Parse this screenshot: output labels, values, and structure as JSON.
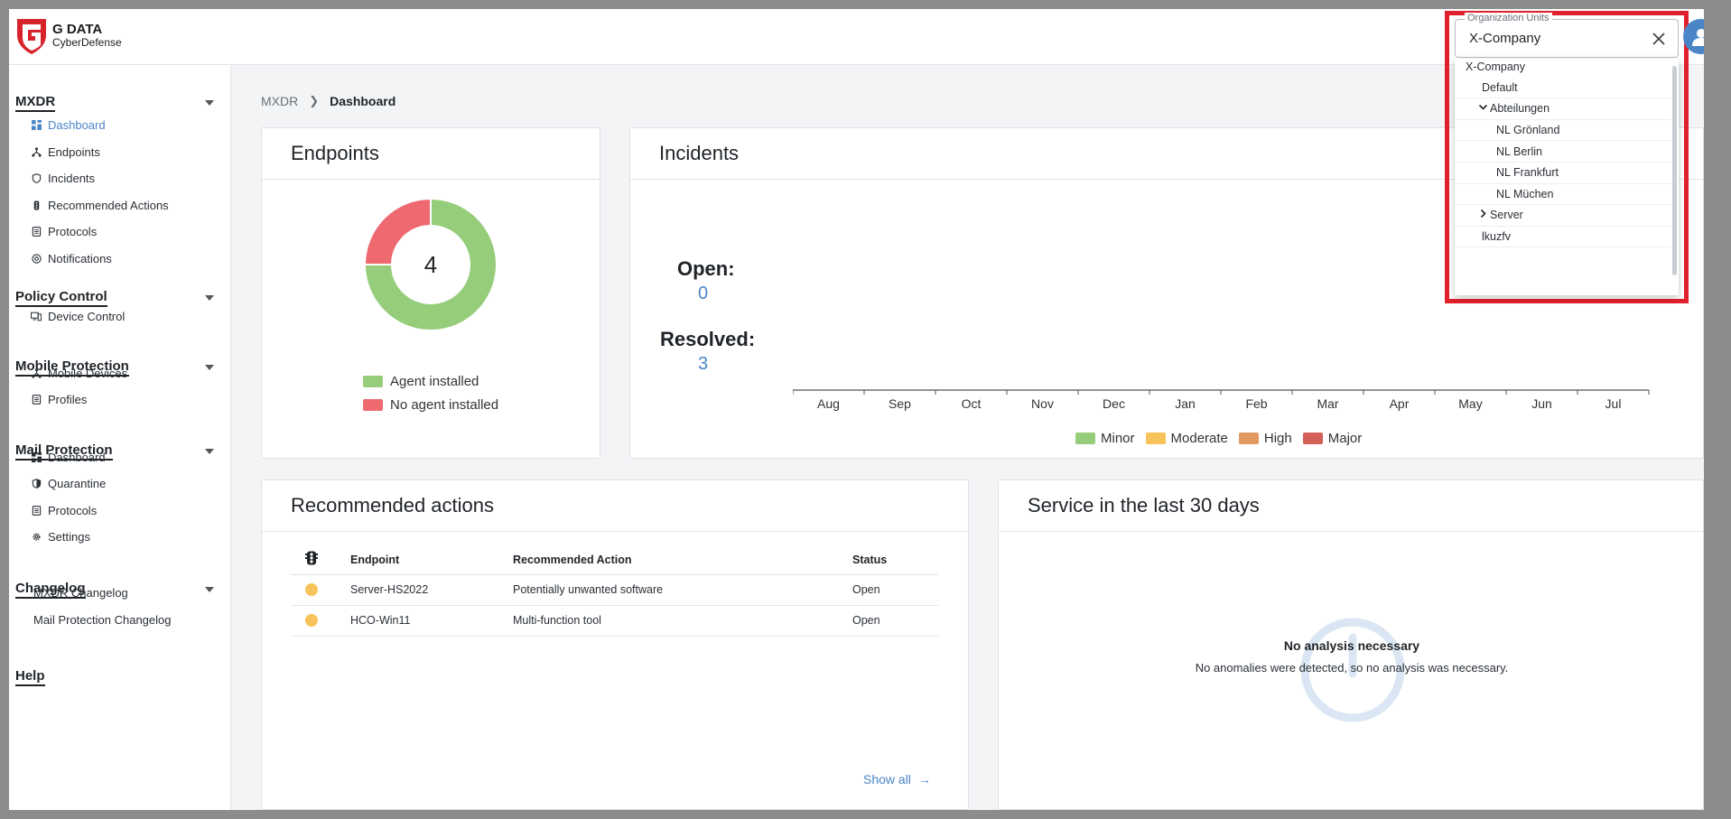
{
  "header": {
    "brand": "G DATA",
    "brand_sub": "CyberDefense",
    "org_label": "Organization Units",
    "org_value": "X-Company"
  },
  "org_dropdown": [
    {
      "label": "X-Company",
      "level": 0,
      "toggle": ""
    },
    {
      "label": "Default",
      "level": 1,
      "toggle": ""
    },
    {
      "label": "Abteilungen",
      "level": 1,
      "toggle": "expanded"
    },
    {
      "label": "NL Grönland",
      "level": 2,
      "toggle": ""
    },
    {
      "label": "NL Berlin",
      "level": 2,
      "toggle": ""
    },
    {
      "label": "NL Frankfurt",
      "level": 2,
      "toggle": ""
    },
    {
      "label": "NL Müchen",
      "level": 2,
      "toggle": ""
    },
    {
      "label": "Server",
      "level": 1,
      "toggle": "collapsed"
    },
    {
      "label": "lkuzfv",
      "level": 1,
      "toggle": ""
    }
  ],
  "sidebar": {
    "mxdr": {
      "title": "MXDR",
      "items": [
        "Dashboard",
        "Endpoints",
        "Incidents",
        "Recommended Actions",
        "Protocols",
        "Notifications"
      ]
    },
    "policy": {
      "title": "Policy Control",
      "items": [
        "Device Control"
      ]
    },
    "mobile": {
      "title": "Mobile Protection",
      "items": [
        "Mobile Devices",
        "Profiles"
      ]
    },
    "mail": {
      "title": "Mail Protection",
      "items": [
        "Dashboard",
        "Quarantine",
        "Protocols",
        "Settings"
      ]
    },
    "changelog": {
      "title": "Changelog",
      "items": [
        "MXDR Changelog",
        "Mail Protection Changelog"
      ]
    },
    "help": {
      "title": "Help"
    }
  },
  "breadcrumb": {
    "root": "MXDR",
    "current": "Dashboard"
  },
  "endpoints": {
    "title": "Endpoints",
    "total": "4",
    "slices": [
      {
        "label": "Agent installed",
        "value": 3,
        "color": "#95cd7b"
      },
      {
        "label": "No agent installed",
        "value": 1,
        "color": "#ee6a70"
      }
    ]
  },
  "incidents": {
    "title": "Incidents",
    "open_label": "Open:",
    "open_value": "0",
    "resolved_label": "Resolved:",
    "resolved_value": "3",
    "months": [
      "Aug",
      "Sep",
      "Oct",
      "Nov",
      "Dec",
      "Jan",
      "Feb",
      "Mar",
      "Apr",
      "May",
      "Jun",
      "Jul"
    ],
    "legend": [
      {
        "label": "Minor",
        "color": "#95cd7b"
      },
      {
        "label": "Moderate",
        "color": "#f8c35a"
      },
      {
        "label": "High",
        "color": "#e39a62"
      },
      {
        "label": "Major",
        "color": "#d4605a"
      }
    ]
  },
  "recommended": {
    "title": "Recommended actions",
    "columns": [
      "Endpoint",
      "Recommended Action",
      "Status"
    ],
    "rows": [
      {
        "endpoint": "Server-HS2022",
        "action": "Potentially unwanted software",
        "status": "Open"
      },
      {
        "endpoint": "HCO-Win11",
        "action": "Multi-function tool",
        "status": "Open"
      }
    ],
    "show_all": "Show all"
  },
  "service": {
    "title": "Service in the last 30 days",
    "headline": "No analysis necessary",
    "text": "No anomalies were detected, so no analysis was necessary."
  },
  "colors": {
    "accent": "#4a86c7",
    "highlight": "#e0202d"
  },
  "icons": {
    "logo": "gdata-shield-logo",
    "user": "user-icon",
    "clear": "close-icon"
  }
}
